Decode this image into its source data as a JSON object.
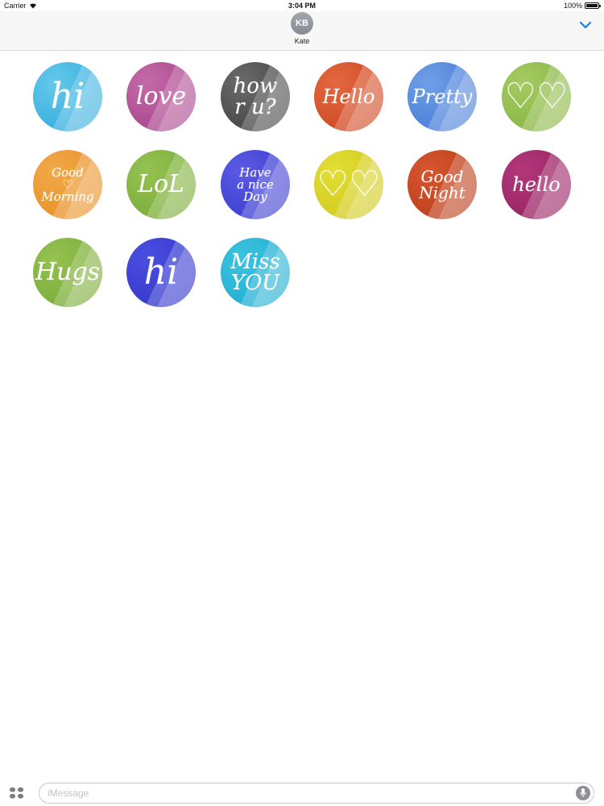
{
  "status_bar": {
    "carrier": "Carrier",
    "time": "3:04 PM",
    "battery": "100%",
    "battery_level": 1.0
  },
  "header": {
    "avatar_initials": "KB",
    "contact_name": "Kate",
    "collapse_icon": "chevron-down-icon",
    "accent": "#1a7cf2"
  },
  "stickers": [
    {
      "text": "hi",
      "colors": [
        "#64c8ea",
        "#2ba6dc"
      ]
    },
    {
      "text": "love",
      "colors": [
        "#c46aa8",
        "#a23c86"
      ]
    },
    {
      "text": "how\nr u?",
      "colors": [
        "#6a6a6a",
        "#3c3c3c"
      ]
    },
    {
      "text": "Hello",
      "colors": [
        "#e2683f",
        "#c9401d"
      ]
    },
    {
      "text": "Pretty",
      "colors": [
        "#6f9fe6",
        "#3f74d4"
      ]
    },
    {
      "text": "♡♡",
      "colors": [
        "#a6ca62",
        "#7fb03a"
      ]
    },
    {
      "text": "Good\n♡\nMorning",
      "colors": [
        "#f2a948",
        "#e58a1f"
      ]
    },
    {
      "text": "LoL",
      "colors": [
        "#95c251",
        "#73a632"
      ]
    },
    {
      "text": "Have\na nice\nDay",
      "colors": [
        "#5a5ae4",
        "#3536c9"
      ]
    },
    {
      "text": "♡♡",
      "colors": [
        "#e3de34",
        "#ccc41a"
      ]
    },
    {
      "text": "Good\nNight",
      "colors": [
        "#d6552e",
        "#b33a18"
      ]
    },
    {
      "text": "hello",
      "colors": [
        "#b2377a",
        "#8f1f5d"
      ]
    },
    {
      "text": "Hugs",
      "colors": [
        "#95c251",
        "#73a632"
      ]
    },
    {
      "text": "hi",
      "colors": [
        "#4b4fe0",
        "#2e31c4"
      ]
    },
    {
      "text": "Miss\nYOU",
      "colors": [
        "#3dc2e0",
        "#1aa9cc"
      ]
    }
  ],
  "composer": {
    "placeholder": "iMessage",
    "apps_icon": "apps-grid-icon",
    "mic_icon": "microphone-icon"
  }
}
